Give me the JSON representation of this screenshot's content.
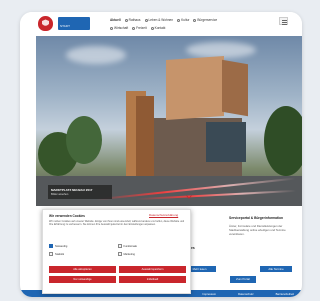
{
  "header": {
    "nav_primary": [
      "Aktuell",
      "Rathaus",
      "Leben & Wohnen",
      "Kultur",
      "Bürgerservice"
    ],
    "nav_secondary": [
      "Wirtschaft",
      "Freizeit",
      "Kontakt"
    ],
    "logo_sub": "STADT"
  },
  "hero": {
    "caption_title": "MARKTPLATZ NEUBAU 2017",
    "caption_sub": "Bilder ansehen"
  },
  "content": {
    "left_title": "Aktuelles",
    "right_title": "Serviceportal & Bürgerinformation",
    "right_text": "Ämter, Formulare und Dienstleistungen der Stadtverwaltung online erledigen und Termine vereinbaren.",
    "btn_a": "Mehr lesen",
    "btn_b": "Zum Portal",
    "btn_c": "Alle Termine"
  },
  "footer": {
    "links": [
      "Impressum",
      "Datenschutz",
      "Barrierefreiheit"
    ]
  },
  "cookie": {
    "title": "Wir verwenden Cookies",
    "top_link": "Datenschutzerklärung",
    "text": "Wir nutzen Cookies auf unserer Website. Einige von ihnen sind essenziell, während andere uns helfen, diese Website und Ihre Erfahrung zu verbessern. Sie können Ihre Auswahl jederzeit in den Einstellungen anpassen.",
    "options": [
      "Notwendig",
      "Funktionale",
      "Statistik",
      "Marketing"
    ],
    "buttons": [
      "Alle akzeptieren",
      "Auswahl speichern",
      "Nur notwendige",
      "Individuell"
    ]
  },
  "colors": {
    "brand_red": "#c9262c",
    "brand_blue": "#1f66b3"
  }
}
